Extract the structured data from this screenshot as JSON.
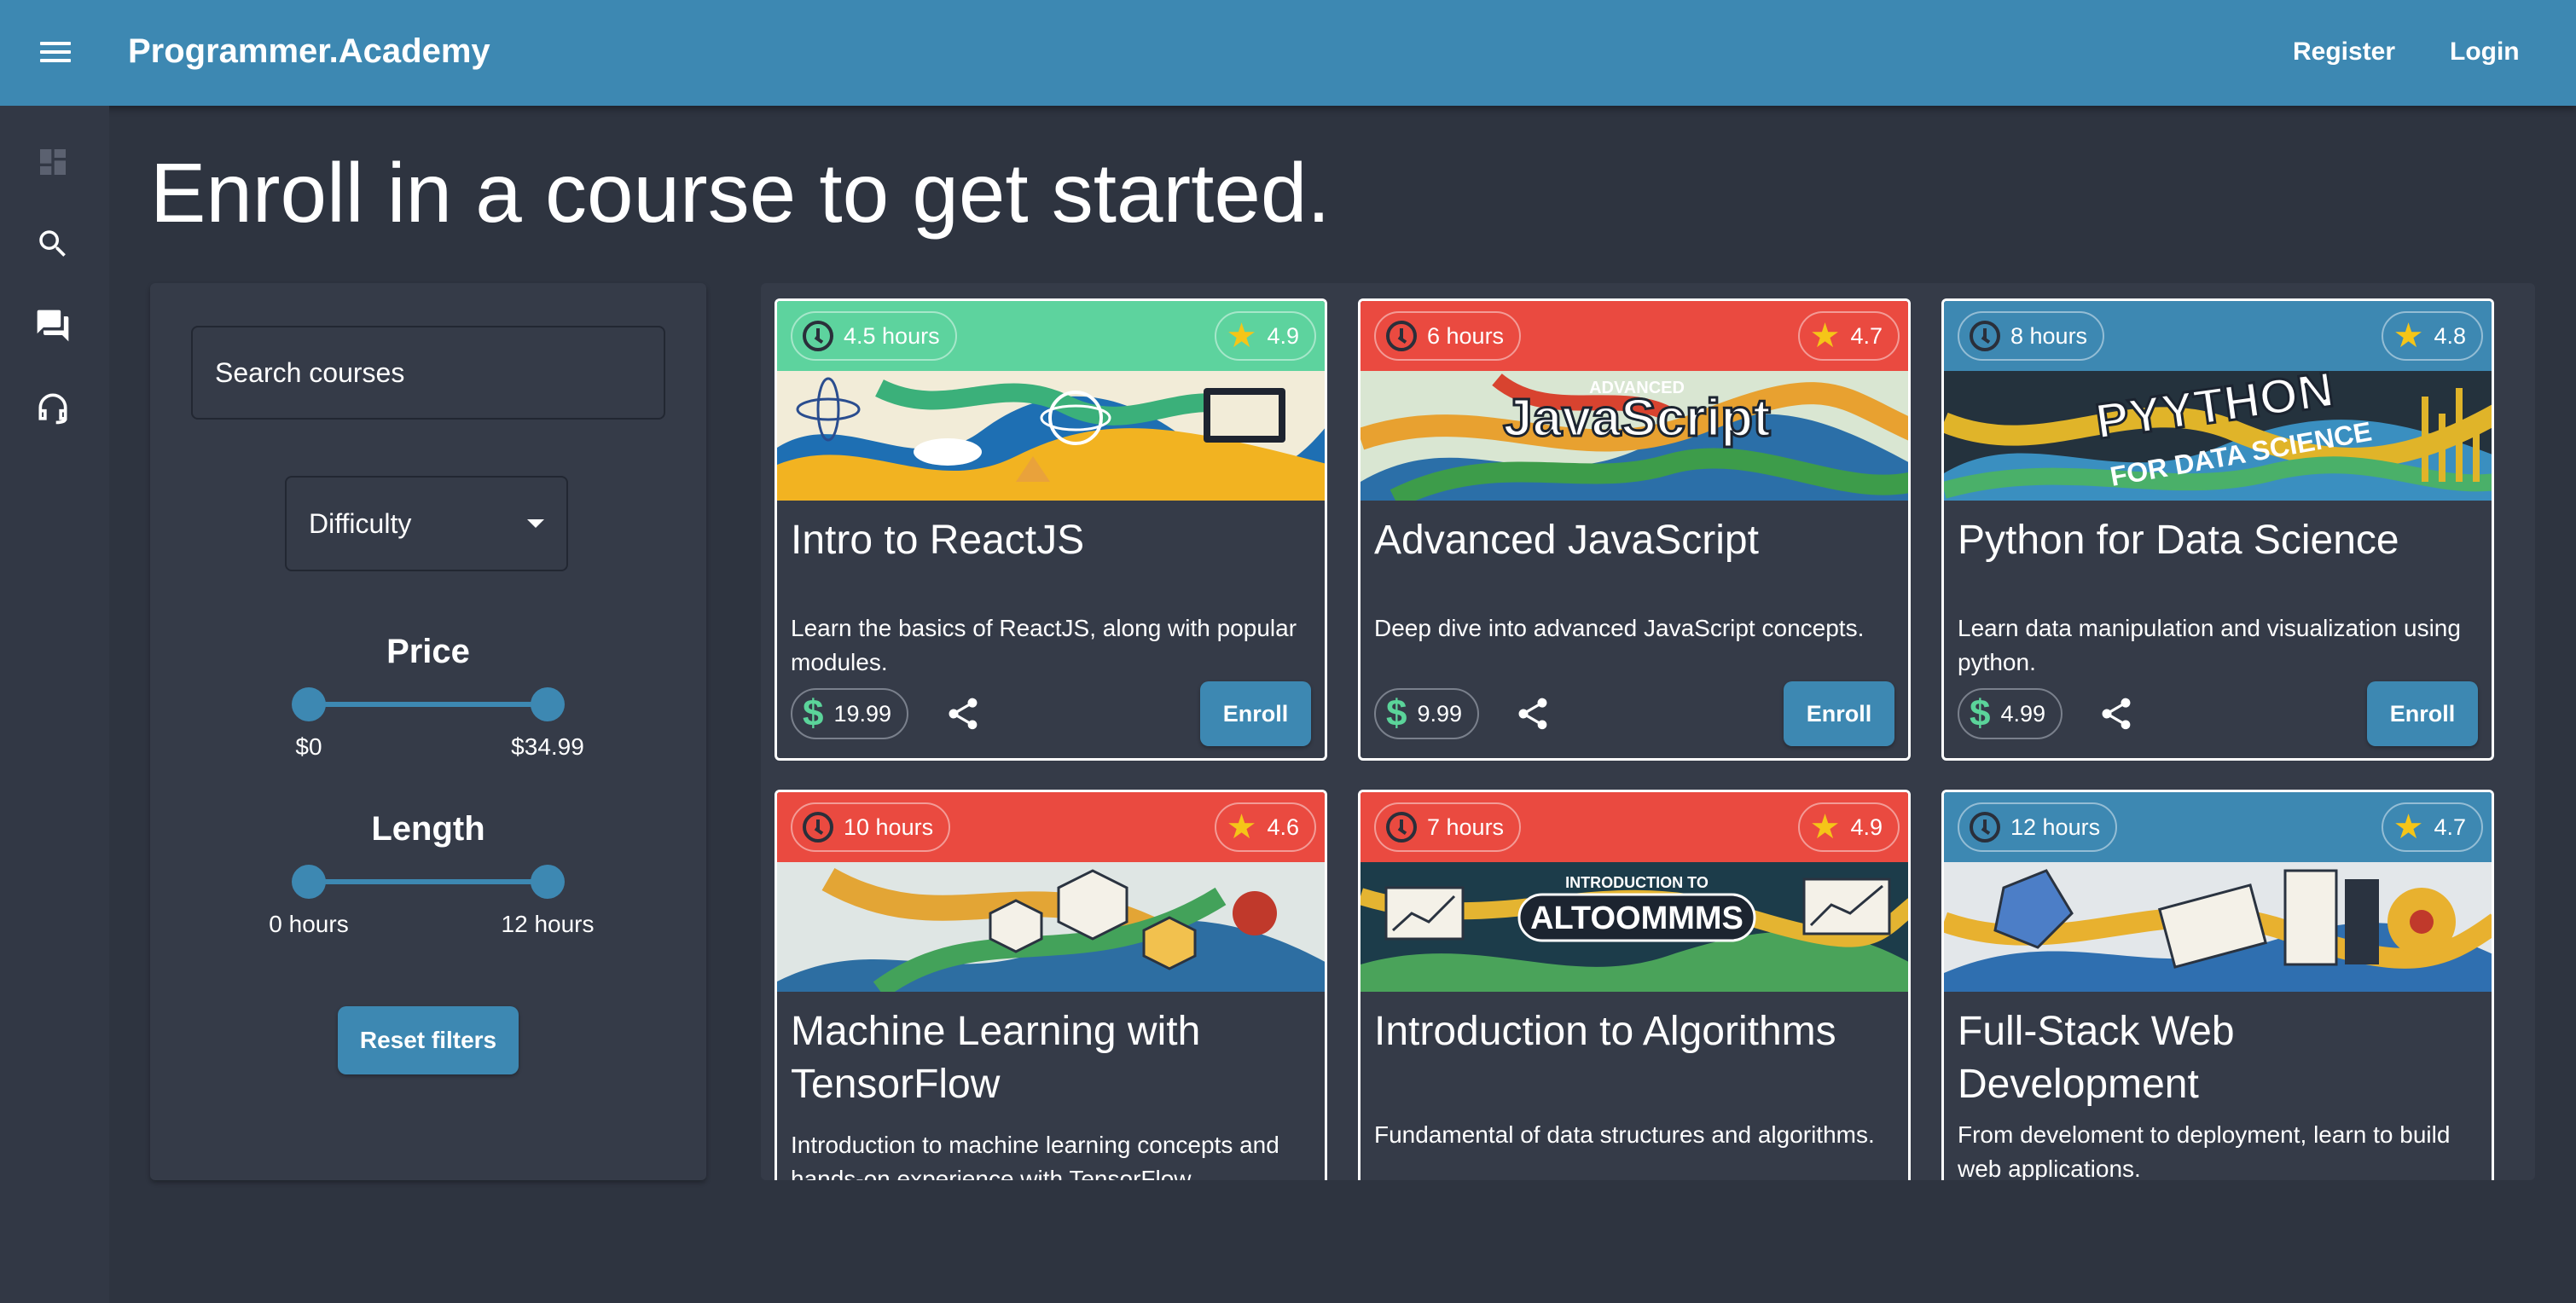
{
  "appbar": {
    "brand": "Programmer.Academy",
    "register": "Register",
    "login": "Login"
  },
  "rail": {
    "icons": [
      "dashboard-icon",
      "search-icon",
      "forum-icon",
      "support-agent-icon"
    ]
  },
  "page": {
    "heading": "Enroll in a course to get started."
  },
  "filters": {
    "search_placeholder": "Search courses",
    "difficulty_label": "Difficulty",
    "price_title": "Price",
    "price_min_label": "$0",
    "price_max_label": "$34.99",
    "price_range_selected": [
      0,
      34.99
    ],
    "length_title": "Length",
    "length_min_label": "0 hours",
    "length_max_label": "12 hours",
    "length_range_selected": [
      0,
      12
    ],
    "reset_label": "Reset filters"
  },
  "colors": {
    "brand": "#3d88b2",
    "difficulty_easy": "#5dd39e",
    "difficulty_hard": "#ea4a40",
    "difficulty_medium": "#3d88b2"
  },
  "courses": [
    {
      "duration": "4.5 hours",
      "rating": "4.9",
      "title": "Intro to ReactJS",
      "description": "Learn the basics of ReactJS, along with popular modules.",
      "price": "19.99",
      "enroll": "Enroll",
      "header_color": "#5dd39e"
    },
    {
      "duration": "6 hours",
      "rating": "4.7",
      "title": "Advanced JavaScript",
      "description": "Deep dive into advanced JavaScript concepts.",
      "price": "9.99",
      "enroll": "Enroll",
      "header_color": "#ea4a40",
      "image_text": "JavaScript",
      "image_small_text": "ADVANCED"
    },
    {
      "duration": "8 hours",
      "rating": "4.8",
      "title": "Python for Data Science",
      "description": "Learn data manipulation and visualization using python.",
      "price": "4.99",
      "enroll": "Enroll",
      "header_color": "#3d88b2",
      "image_text": "PYYTHON",
      "image_small_text": "FOR DATA SCIENCE"
    },
    {
      "duration": "10 hours",
      "rating": "4.6",
      "title": "Machine Learning with TensorFlow",
      "description": "Introduction to machine learning concepts and hands-on experience with TensorFlow.",
      "header_color": "#ea4a40"
    },
    {
      "duration": "7 hours",
      "rating": "4.9",
      "title": "Introduction to Algorithms",
      "description": "Fundamental of data structures and algorithms.",
      "header_color": "#ea4a40",
      "image_text": "ALTOOMMMS",
      "image_small_text": "INTRODUCTION TO"
    },
    {
      "duration": "12 hours",
      "rating": "4.7",
      "title": "Full-Stack Web Development",
      "description": "From develoment to deployment, learn to build web applications.",
      "header_color": "#3d88b2"
    }
  ]
}
